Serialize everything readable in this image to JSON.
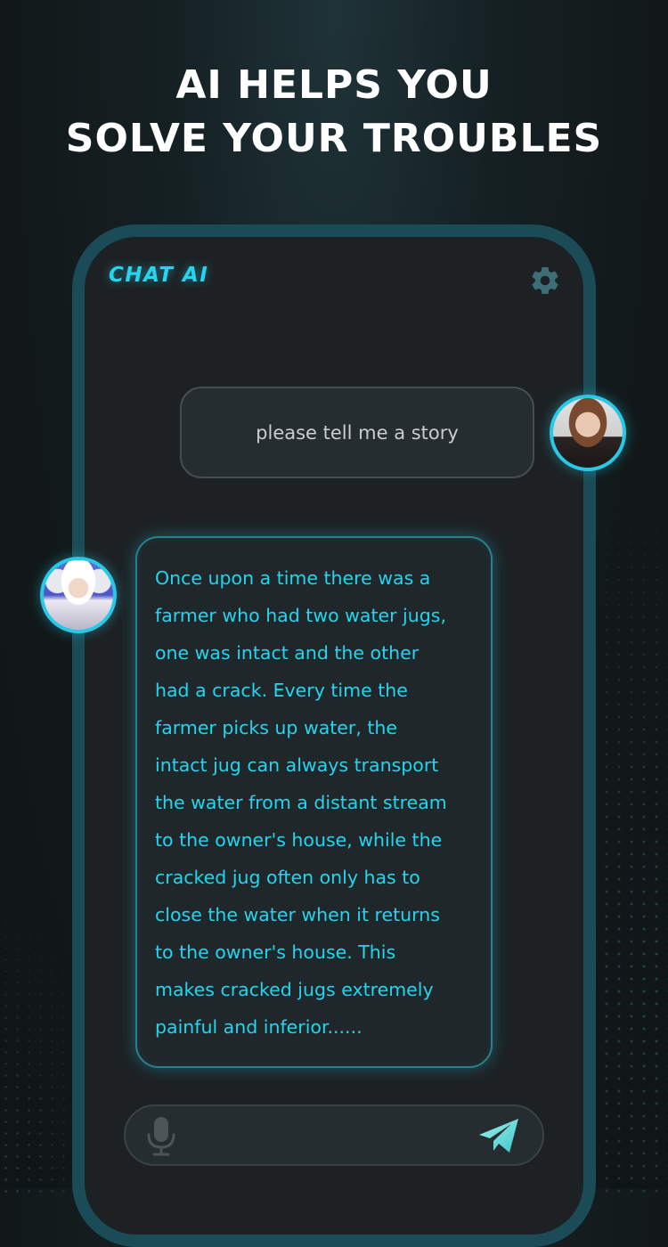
{
  "headline": {
    "line1": "AI HELPS YOU",
    "line2": "SOLVE YOUR TROUBLES"
  },
  "app": {
    "title": "CHAT AI",
    "settings_icon": "gear-icon",
    "accent_color": "#25d4ee",
    "frame_color": "#1a4b56"
  },
  "chat": {
    "user_message": "please tell me a story",
    "ai_message_lines": [
      "Once upon a time there was a",
      "farmer who had two water jugs,",
      "one was intact and the other",
      "had a crack. Every time the",
      "farmer picks up water, the",
      "intact jug can always transport",
      "the water from a distant stream",
      "to the owner's house, while the",
      "cracked jug often only has to",
      "close the water when it returns",
      "to the owner's house. This",
      "makes cracked jugs extremely",
      "painful and inferior......"
    ]
  },
  "input": {
    "mic_icon": "microphone-icon",
    "send_icon": "send-icon"
  }
}
